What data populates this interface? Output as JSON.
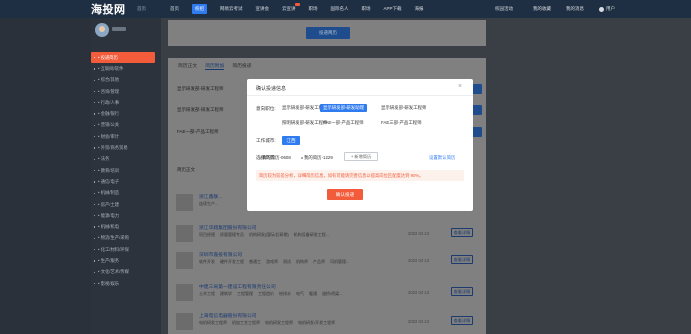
{
  "header": {
    "logo": "海投网",
    "logo_sub": "首页",
    "nav": [
      {
        "label": "首页"
      },
      {
        "label": "校招"
      },
      {
        "label": "网易云考试"
      },
      {
        "label": "宣讲会"
      },
      {
        "label": "云宣讲"
      },
      {
        "label": "职场"
      },
      {
        "label": "国际名人"
      },
      {
        "label": "职场"
      },
      {
        "label": "APP下载"
      },
      {
        "label": "海报"
      }
    ],
    "right": {
      "item1": "校园活动",
      "item2": "我的收藏",
      "item3": "我的消息",
      "user": "用户"
    }
  },
  "sidebar": {
    "items": [
      {
        "label": "• 投递简历",
        "active": true
      },
      {
        "label": "• 互联网/软件"
      },
      {
        "label": "• 综合/其他"
      },
      {
        "label": "• 咨询/管理"
      },
      {
        "label": "• 行政/人事"
      },
      {
        "label": "• 金融/银行"
      },
      {
        "label": "• 营销/公关"
      },
      {
        "label": "• 财会/审计"
      },
      {
        "label": "• 外贸/商务贸易"
      },
      {
        "label": "• 法务"
      },
      {
        "label": "• 教育/培训"
      },
      {
        "label": "• 通信/电子"
      },
      {
        "label": "• 机械/制造"
      },
      {
        "label": "• 房产/土建"
      },
      {
        "label": "• 能源/电力"
      },
      {
        "label": "• 机械/机电"
      },
      {
        "label": "• 物流/生产/采购"
      },
      {
        "label": "• 化工/材料/环保"
      },
      {
        "label": "• 生产/服务"
      },
      {
        "label": "• 文化/艺术/传媒"
      },
      {
        "label": "• 影视/娱乐"
      }
    ]
  },
  "background": {
    "top_button": "投递简历",
    "tabs": [
      "简历正文",
      "简历附加",
      "简历投递"
    ],
    "rows_text": [
      "显示研发部-研发工程师",
      "显示研发部-研发工程师",
      "FAE一部-产品工程师"
    ],
    "section_label": "简历正文",
    "companies": [
      {
        "name": "浙江鑫联...",
        "tags": [
          "连续生产..."
        ],
        "date": "",
        "btn": "查看详情"
      },
      {
        "name": "浙江华翔集团股份有限公司",
        "tags": [
          "项目经理",
          "质量管理专员",
          "机构研发(国际/后研期)",
          "机构设备研发工程..."
        ],
        "date": "2022 04 13",
        "btn": "查看详情"
      },
      {
        "name": "深圳市嘉投有限公司",
        "tags": [
          "软件开发",
          "硬件开发工程",
          "普通工",
          "游戏师",
          "测试",
          "机构师",
          "产品师",
          "司机管理..."
        ],
        "date": "2022 04 13",
        "btn": "查看详情"
      },
      {
        "name": "中建三局第一建设工程有限责任公司",
        "tags": [
          "土木工程",
          "建筑学",
          "工程管理",
          "工程造价",
          "给排水",
          "电气",
          "暖通",
          "道桥/桥梁..."
        ],
        "date": "2022 04 13",
        "btn": "查看详情"
      },
      {
        "name": "上海电信电器股份有限公司",
        "tags": [
          "电机研发工程师",
          "机加工艺工程师",
          "电机研发工程师",
          "电机研发/开发工程师"
        ],
        "date": "2022 04 13",
        "btn": "查看详情"
      }
    ]
  },
  "modal": {
    "title": "确认投递信息",
    "close_icon": "×",
    "position_label": "意向职位:",
    "positions": [
      {
        "label": "显示研发部-研发工程师",
        "selected": false
      },
      {
        "label": "显示研发部-研发助理",
        "selected": true
      },
      {
        "label": "显示研发部-研发工程师",
        "selected": false
      },
      {
        "label": "照明研发部-研发工程师",
        "selected": false
      },
      {
        "label": "FAE一部-产品工程师",
        "selected": false
      },
      {
        "label": "FAE三部-产品工程师",
        "selected": false
      }
    ],
    "city_label": "工作城市:",
    "city": "江西",
    "resume_label": "选择简历:",
    "resumes": [
      "我的简历-0608",
      "我的简历-1229"
    ],
    "new_resume": "+ 新增简历",
    "default_link": "设置默认简历",
    "warning": "简历较为较差分析，详细简历信息，如有可能请完善信息以提高岗位匹配度达到 90%。",
    "confirm": "确认投递"
  }
}
